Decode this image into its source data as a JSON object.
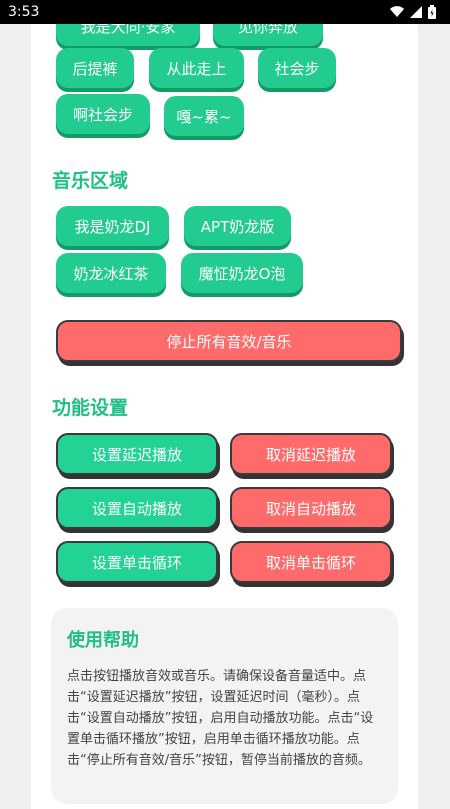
{
  "status": {
    "time": "3:53"
  },
  "top_partial": [
    "我是大同·安家",
    "见你奔放"
  ],
  "effects_rows": [
    [
      "后提裤",
      "从此走上",
      "社会步"
    ],
    [
      "啊社会步",
      "嘎~累~"
    ]
  ],
  "music": {
    "title": "音乐区域",
    "items": [
      "我是奶龙DJ",
      "APT奶龙版",
      "奶龙冰红茶",
      "魔怔奶龙O泡"
    ],
    "stop_all": "停止所有音效/音乐"
  },
  "settings": {
    "title": "功能设置",
    "set_delay": "设置延迟播放",
    "cancel_delay": "取消延迟播放",
    "set_auto": "设置自动播放",
    "cancel_auto": "取消自动播放",
    "set_loop": "设置单击循环",
    "cancel_loop": "取消单击循环"
  },
  "help": {
    "title": "使用帮助",
    "text": "点击按钮播放音效或音乐。请确保设备音量适中。点击“设置延迟播放”按钮，设置延迟时间（毫秒）。点击“设置自动播放”按钮，启用自动播放功能。点击“设置单击循环播放”按钮，启用单击循环播放功能。点击“停止所有音效/音乐”按钮，暂停当前播放的音频。"
  },
  "colors": {
    "accent": "#22cc8e",
    "danger": "#ff6b6b",
    "title": "#1fbf85"
  }
}
